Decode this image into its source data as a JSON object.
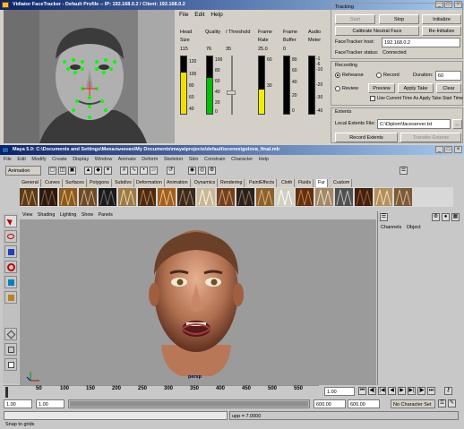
{
  "facetracker": {
    "title": "Vidiator FaceTracker - Default Profile -- IP: 192.168.0.2 / Client: 192.168.0.2",
    "menu": [
      "File",
      "Edit",
      "Help"
    ],
    "columns": {
      "head_size": {
        "label1": "Head",
        "label2": "Size",
        "value": "115",
        "ticks": [
          "120",
          "100",
          "80",
          "60",
          "40"
        ],
        "level": 0.72,
        "color": "#f0e000"
      },
      "quality": {
        "label1": "Quality",
        "value": "76",
        "ticks": [
          "100",
          "80",
          "60",
          "40",
          "20",
          "0"
        ],
        "level": 0.62,
        "color": "#00c000"
      },
      "threshold": {
        "label1": "/ Threshold",
        "value": "35",
        "level": 0.35
      },
      "frame_rate": {
        "label1": "Frame",
        "label2": "Rate",
        "value": "25.0",
        "ticks": [
          "60",
          "30"
        ],
        "level": 0.42,
        "color": "#f0f000"
      },
      "frame_buffer": {
        "label1": "Frame",
        "label2": "Buffer",
        "value": "0",
        "ticks": [
          "80",
          "60",
          "40",
          "20",
          "0"
        ],
        "level": 0
      },
      "audio_meter": {
        "label1": "Audio",
        "label2": "Meter",
        "ticks": [
          "-1",
          "-6",
          "-10",
          "-20",
          "-30",
          "-40"
        ],
        "level": 0
      }
    },
    "tracking": {
      "title": "Tracking",
      "start_label": "Start",
      "stop_label": "Stop",
      "initialize_label": "Initialize",
      "calibrate_label": "Calibrate Neutral Face",
      "reinitialize_label": "Re-Initialize",
      "host_label": "FaceTracker host:",
      "host_value": "192.168.0.2",
      "status_label": "FaceTracker status:",
      "status_value": "Connected"
    },
    "recording": {
      "title": "Recording",
      "rehearse_label": "Rehearse",
      "record_label": "Record",
      "duration_label": "Duration:",
      "duration_value": "60",
      "review_label": "Review",
      "preview_label": "Preview",
      "apply_take_label": "Apply Take",
      "clear_label": "Clear",
      "use_current_time_label": "Use Current Time As Apply Take Start Time"
    },
    "extents": {
      "title": "Extents",
      "file_label": "Local Extents File:",
      "file_value": "C:\\Diplom\\faceserver.txt",
      "browse_label": "...",
      "record_label": "Record Extents",
      "transfer_label": "Transfer Extents"
    }
  },
  "maya": {
    "title": "Maya 5.0: C:\\Documents and Settings\\Михальченко\\My Documents\\maya\\projects\\default\\scenes\\golova_final.mb",
    "menu": [
      "File",
      "Edit",
      "Modify",
      "Create",
      "Display",
      "Window",
      "Animate",
      "Deform",
      "Skeleton",
      "Skin",
      "Constrain",
      "Character",
      "Help"
    ],
    "mode_select": "Animation",
    "shelf_tabs": [
      "General",
      "Curves",
      "Surfaces",
      "Polygons",
      "Subdivs",
      "Deformation",
      "Animation",
      "Dynamics",
      "Rendering",
      "PaintEffects",
      "Cloth",
      "Fluids",
      "Fur",
      "Custom"
    ],
    "active_shelf": "Fur",
    "panel_menu": [
      "View",
      "Shading",
      "Lighting",
      "Show",
      "Panels"
    ],
    "camera_label": "persp",
    "channel_box": [
      "Channels",
      "Object"
    ],
    "ruler": [
      "50",
      "100",
      "150",
      "200",
      "250",
      "300",
      "350",
      "400",
      "450",
      "500",
      "550"
    ],
    "current_frame": "1.00",
    "range": {
      "start": "1.00",
      "start2": "1.00",
      "end": "600.00",
      "end2": "600.00",
      "character_set": "No Character Set"
    },
    "command_line": "upp = 7.0000",
    "help_line": "Snap to grids"
  }
}
